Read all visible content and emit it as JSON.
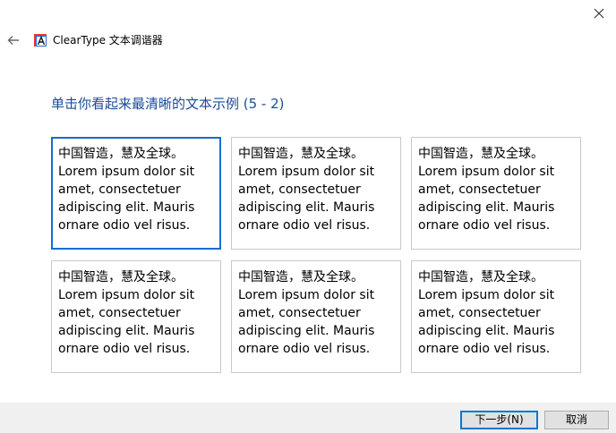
{
  "window": {
    "title": "ClearType 文本调谐器",
    "close_icon": "close-icon",
    "back_icon": "back-arrow-icon",
    "app_icon": "cleartype-icon"
  },
  "heading": "单击你看起来最清晰的文本示例 (5 - 2)",
  "samples": [
    {
      "text": "中国智造，慧及全球。\nLorem ipsum dolor sit amet, consectetuer adipiscing elit. Mauris ornare odio vel risus.",
      "selected": true
    },
    {
      "text": "中国智造，慧及全球。\nLorem ipsum dolor sit amet, consectetuer adipiscing elit. Mauris ornare odio vel risus.",
      "selected": false
    },
    {
      "text": "中国智造，慧及全球。\nLorem ipsum dolor sit amet, consectetuer adipiscing elit. Mauris ornare odio vel risus.",
      "selected": false
    },
    {
      "text": "中国智造，慧及全球。\nLorem ipsum dolor sit amet, consectetuer adipiscing elit. Mauris ornare odio vel risus.",
      "selected": false
    },
    {
      "text": "中国智造，慧及全球。\nLorem ipsum dolor sit amet, consectetuer adipiscing elit. Mauris ornare odio vel risus.",
      "selected": false
    },
    {
      "text": "中国智造，慧及全球。\nLorem ipsum dolor sit amet, consectetuer adipiscing elit. Mauris ornare odio vel risus.",
      "selected": false
    }
  ],
  "buttons": {
    "next": "下一步(N)",
    "cancel": "取消"
  },
  "colors": {
    "heading": "#1a4b99",
    "selection_border": "#1a6ccc",
    "footer_background": "#f0f0f0"
  }
}
